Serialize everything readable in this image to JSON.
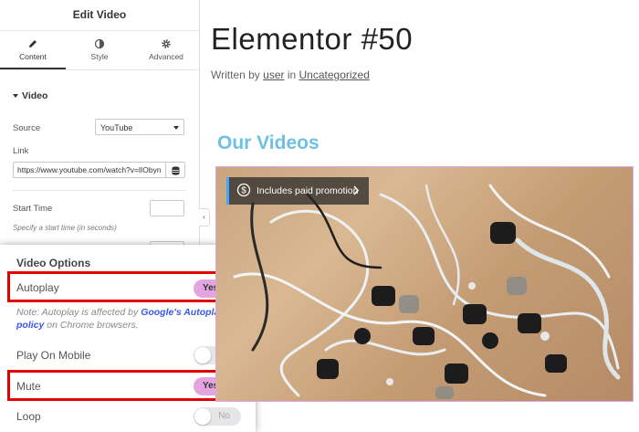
{
  "panel": {
    "title": "Edit Video",
    "tabs": [
      {
        "label": "Content",
        "icon": "pencil-icon"
      },
      {
        "label": "Style",
        "icon": "half-circle-icon"
      },
      {
        "label": "Advanced",
        "icon": "gear-icon"
      }
    ],
    "section_title": "Video",
    "source": {
      "label": "Source",
      "value": "YouTube"
    },
    "link": {
      "label": "Link",
      "value": "https://www.youtube.com/watch?v=lIObyn"
    },
    "start_time": {
      "label": "Start Time",
      "hint": "Specify a start time (in seconds)"
    }
  },
  "callout": {
    "title": "Video Options",
    "autoplay": {
      "label": "Autoplay",
      "value": "Yes"
    },
    "note": {
      "prefix": "Note: Autoplay is affected by ",
      "link": "Google's Autoplay policy",
      "suffix": " on Chrome browsers."
    },
    "play_on_mobile": {
      "label": "Play On Mobile",
      "value": "No"
    },
    "mute": {
      "label": "Mute",
      "value": "Yes"
    },
    "loop": {
      "label": "Loop",
      "value": "No"
    }
  },
  "page": {
    "title": "Elementor #50",
    "byline": {
      "written_by": "Written by ",
      "author": "user",
      "in": " in ",
      "category": "Uncategorized"
    },
    "section_heading": "Our Videos",
    "video": {
      "promo_text": "Includes paid promotion"
    }
  },
  "colors": {
    "accent_toggle_on": "#e2a5e0",
    "highlight": "#e00000",
    "heading_blue": "#6ec1e4",
    "link_blue": "#3858e9"
  }
}
